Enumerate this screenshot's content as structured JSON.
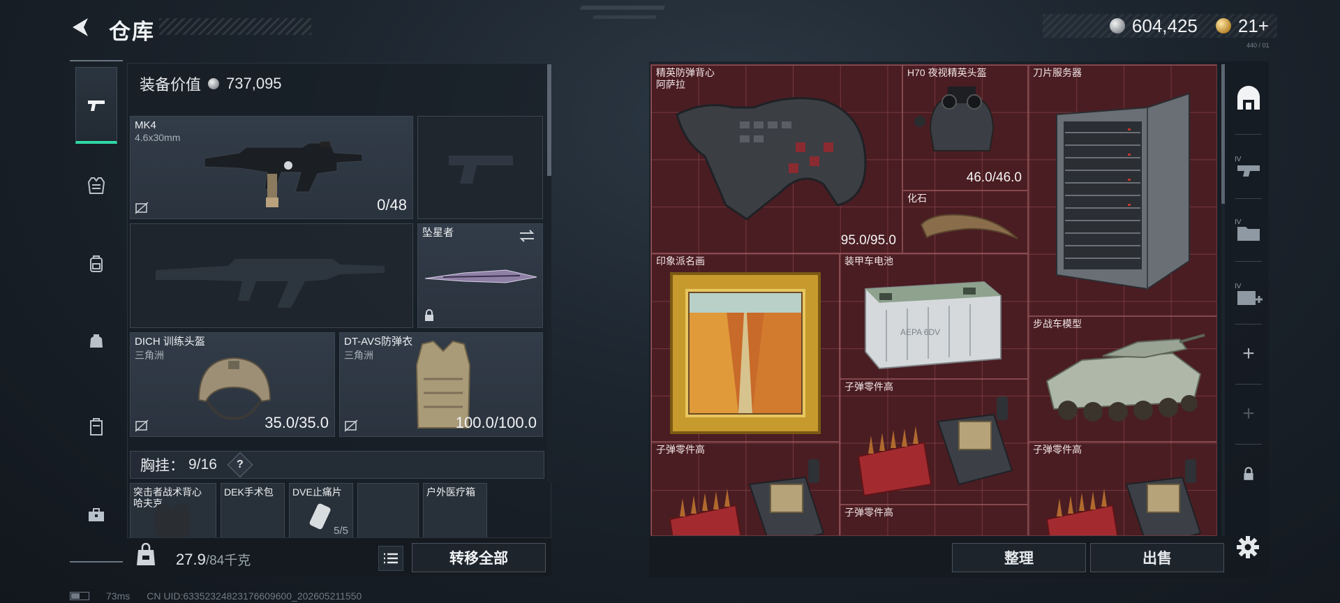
{
  "header": {
    "title": "仓库",
    "currency_primary": "604,425",
    "currency_secondary": "21+",
    "currency_sub": "440 / 01"
  },
  "loadout": {
    "value_label": "装备价值",
    "value": "737,095",
    "primary_weapon": {
      "name": "MK4",
      "caliber": "4.6x30mm",
      "ammo": "0/48"
    },
    "melee": {
      "name": "坠星者"
    },
    "helmet": {
      "name": "DICH 训练头盔",
      "origin": "三角洲",
      "durability": "35.0/35.0"
    },
    "armor": {
      "name": "DT-AVS防弹衣",
      "origin": "三角洲",
      "durability": "100.0/100.0"
    },
    "rig": {
      "label": "胸挂：",
      "capacity": "9/16",
      "help": "?"
    },
    "rig_items": [
      {
        "name": "突击者战术背心",
        "sub": "哈夫克",
        "count": ""
      },
      {
        "name": "DEK手术包",
        "sub": "",
        "count": ""
      },
      {
        "name": "DVE止痛片",
        "sub": "",
        "count": "5/5"
      },
      {
        "name": "",
        "sub": "",
        "count": ""
      },
      {
        "name": "户外医疗箱",
        "sub": "",
        "count": ""
      }
    ]
  },
  "footer_left": {
    "weight": "27.9",
    "weight_max": "/84千克",
    "transfer_label": "转移全部"
  },
  "status": {
    "ping": "73ms",
    "uid": "CN UID:63352324823176609600_202605211550"
  },
  "stash": {
    "items": [
      {
        "name": "精英防弹背心",
        "sub": "阿萨拉",
        "durability": "95.0/95.0"
      },
      {
        "name": "H70 夜视精英头盔",
        "durability": "46.0/46.0"
      },
      {
        "name": "刀片服务器"
      },
      {
        "name": "化石"
      },
      {
        "name": "印象派名画"
      },
      {
        "name": "装甲车电池"
      },
      {
        "name": "步战车模型"
      },
      {
        "name": "子弹零件高"
      },
      {
        "name": "子弹零件高"
      },
      {
        "name": "子弹零件高"
      },
      {
        "name": "子弹零件高"
      }
    ],
    "battery_text": "AEPA 6DV",
    "tab_labels": [
      "IV",
      "IV",
      "IV"
    ]
  },
  "footer_right": {
    "sort_label": "整理",
    "sell_label": "出售"
  },
  "colors": {
    "accent": "#2fd9a6",
    "grid_bg": "#4a1d22",
    "panel_bg": "#1b232c"
  }
}
